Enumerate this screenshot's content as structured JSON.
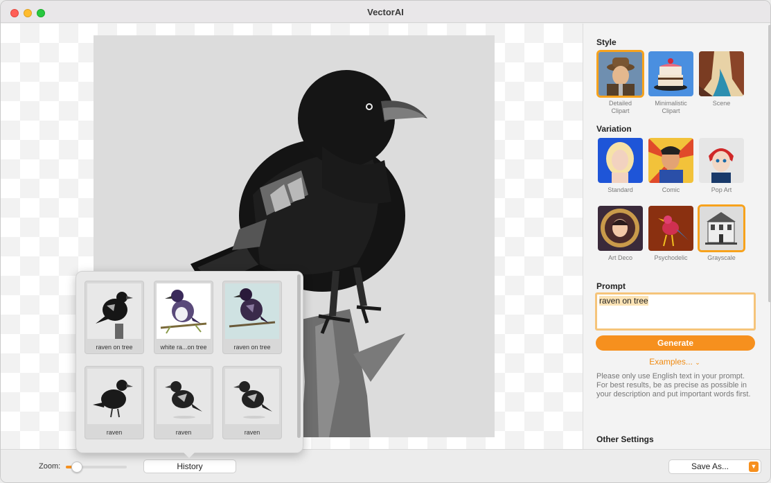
{
  "window": {
    "title": "VectorAI"
  },
  "sidebar": {
    "style_title": "Style",
    "style_items": [
      {
        "label": "Detailed\nClipart",
        "selected": true
      },
      {
        "label": "Minimalistic\nClipart",
        "selected": false
      },
      {
        "label": "Scene",
        "selected": false
      }
    ],
    "variation_title": "Variation",
    "variation_items": [
      {
        "label": "Standard",
        "selected": false
      },
      {
        "label": "Comic",
        "selected": false
      },
      {
        "label": "Pop Art",
        "selected": false
      },
      {
        "label": "Art Deco",
        "selected": false
      },
      {
        "label": "Psychodelic",
        "selected": false
      },
      {
        "label": "Grayscale",
        "selected": true
      }
    ],
    "prompt_title": "Prompt",
    "prompt_value": "raven on tree",
    "generate_label": "Generate",
    "examples_label": "Examples...",
    "help_text": "Please only use English text in your prompt. For best results, be as precise as possible in your description and put important words first.",
    "other_title": "Other Settings"
  },
  "bottom": {
    "zoom_label": "Zoom:",
    "zoom_level": 0.1,
    "history_label": "History",
    "saveas_label": "Save As..."
  },
  "history": {
    "items": [
      {
        "caption": "raven on tree"
      },
      {
        "caption": "white ra...on tree"
      },
      {
        "caption": "raven on tree"
      },
      {
        "caption": "raven"
      },
      {
        "caption": "raven"
      },
      {
        "caption": "raven"
      }
    ]
  },
  "colors": {
    "accent": "#f6901e",
    "selection": "#f7a21c"
  }
}
